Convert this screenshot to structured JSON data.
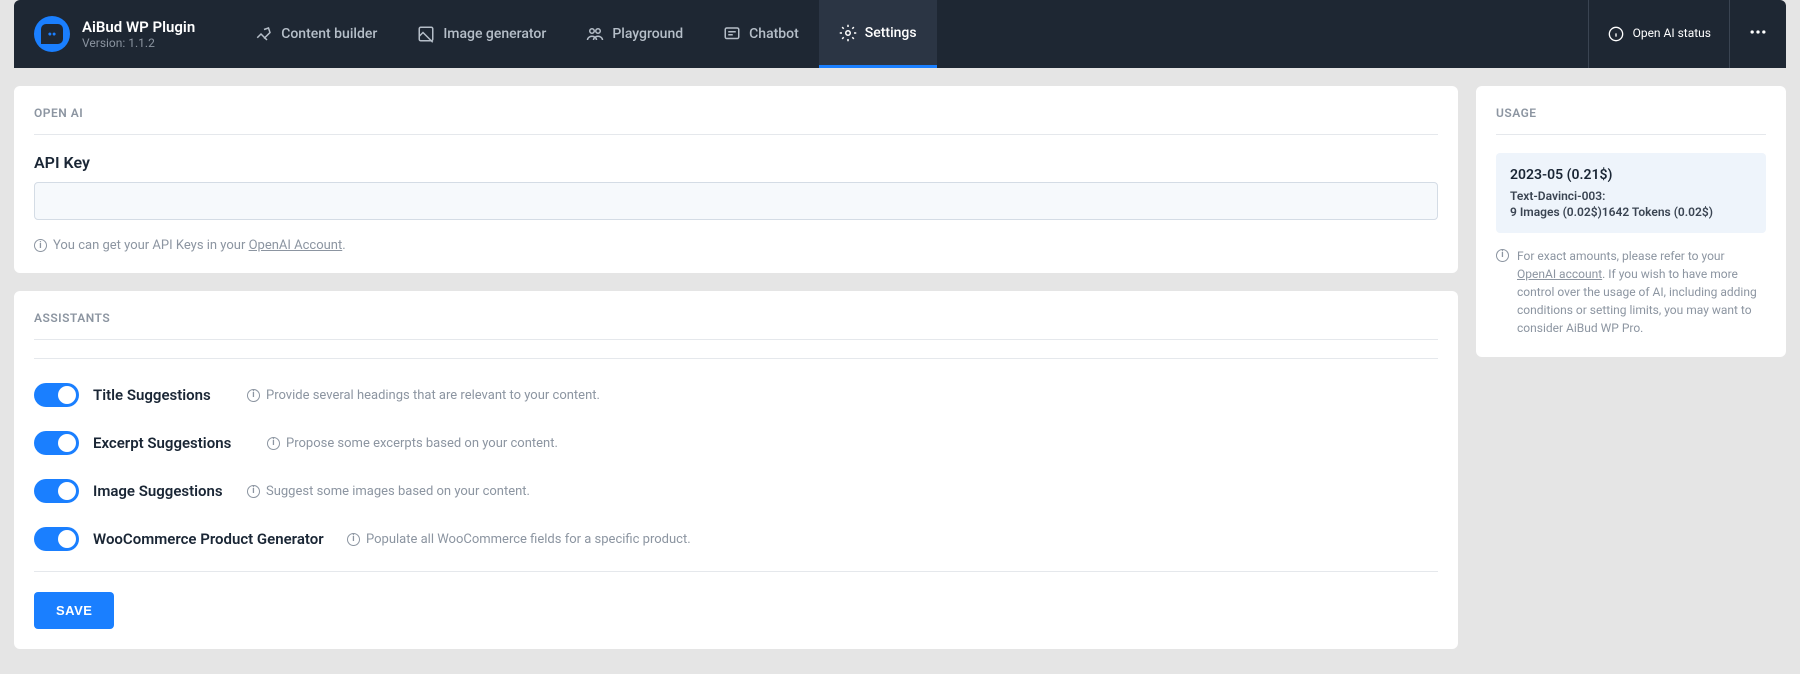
{
  "header": {
    "plugin_name": "AiBud WP Plugin",
    "version": "Version: 1.1.2",
    "nav": {
      "content_builder": "Content builder",
      "image_generator": "Image generator",
      "playground": "Playground",
      "chatbot": "Chatbot",
      "settings": "Settings"
    },
    "status_label": "Open AI status"
  },
  "openai_section": {
    "title": "OPEN AI",
    "api_key_label": "API Key",
    "api_key_value": "",
    "help_text_prefix": "You can get your API Keys in your ",
    "help_link_text": "OpenAI Account",
    "help_text_suffix": "."
  },
  "assistants_section": {
    "title": "ASSISTANTS",
    "items": [
      {
        "label": "Title Suggestions",
        "desc": "Provide several headings that are relevant to your content."
      },
      {
        "label": "Excerpt Suggestions",
        "desc": "Propose some excerpts based on your content."
      },
      {
        "label": "Image Suggestions",
        "desc": "Suggest some images based on your content."
      },
      {
        "label": "WooCommerce Product Generator",
        "desc": "Populate all WooCommerce fields for a specific product."
      }
    ]
  },
  "save_button_label": "SAVE",
  "usage": {
    "title": "USAGE",
    "date": "2023-05 (0.21$)",
    "model": "Text-Davinci-003:",
    "details": "9 Images (0.02$)1642 Tokens (0.02$)",
    "note_prefix": "For exact amounts, please refer to your ",
    "note_link": "OpenAI account",
    "note_suffix": ". If you wish to have more control over the usage of AI, including adding conditions or setting limits, you may want to consider AiBud WP Pro."
  }
}
